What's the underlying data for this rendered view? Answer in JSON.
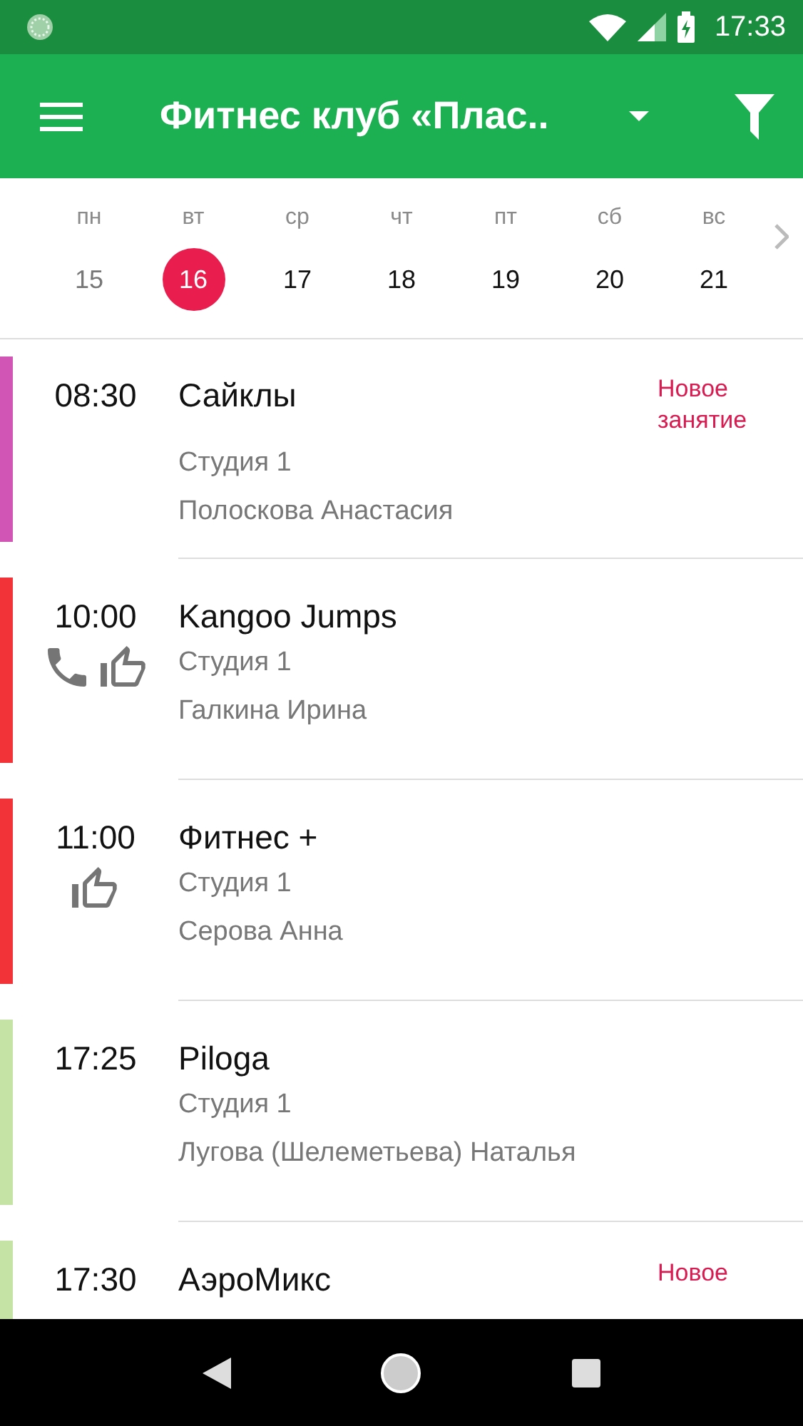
{
  "status_bar": {
    "time": "17:33"
  },
  "app_bar": {
    "title": "Фитнес клуб «Плас.."
  },
  "week": [
    {
      "weekday": "пн",
      "day": "15",
      "selected": false,
      "past": true
    },
    {
      "weekday": "вт",
      "day": "16",
      "selected": true,
      "past": false
    },
    {
      "weekday": "ср",
      "day": "17",
      "selected": false,
      "past": false
    },
    {
      "weekday": "чт",
      "day": "18",
      "selected": false,
      "past": false
    },
    {
      "weekday": "пт",
      "day": "19",
      "selected": false,
      "past": false
    },
    {
      "weekday": "сб",
      "day": "20",
      "selected": false,
      "past": false
    },
    {
      "weekday": "вс",
      "day": "21",
      "selected": false,
      "past": false
    }
  ],
  "classes": [
    {
      "time": "08:30",
      "title": "Сайклы",
      "room": "Студия 1",
      "trainer": "Полоскова Анастасия",
      "badge": "Новое занятие",
      "color": "#d155b5"
    },
    {
      "time": "10:00",
      "title": "Kangoo Jumps",
      "room": "Студия 1",
      "trainer": "Галкина Ирина",
      "color": "#f23439",
      "icons": [
        {
          "kind": "phone"
        },
        {
          "kind": "like"
        }
      ]
    },
    {
      "time": "11:00",
      "title": "Фитнес +",
      "room": "Студия 1",
      "trainer": "Серова Анна",
      "color": "#f23439",
      "icons": [
        {
          "kind": "like"
        }
      ]
    },
    {
      "time": "17:25",
      "title": "Piloga",
      "room": "Студия 1",
      "trainer": "Лугова (Шелеметьева) Наталья",
      "color": "#c5e3a4"
    },
    {
      "time": "17:30",
      "title": "АэроМикс",
      "badge": "Новое",
      "color": "#c5e3a4"
    }
  ]
}
